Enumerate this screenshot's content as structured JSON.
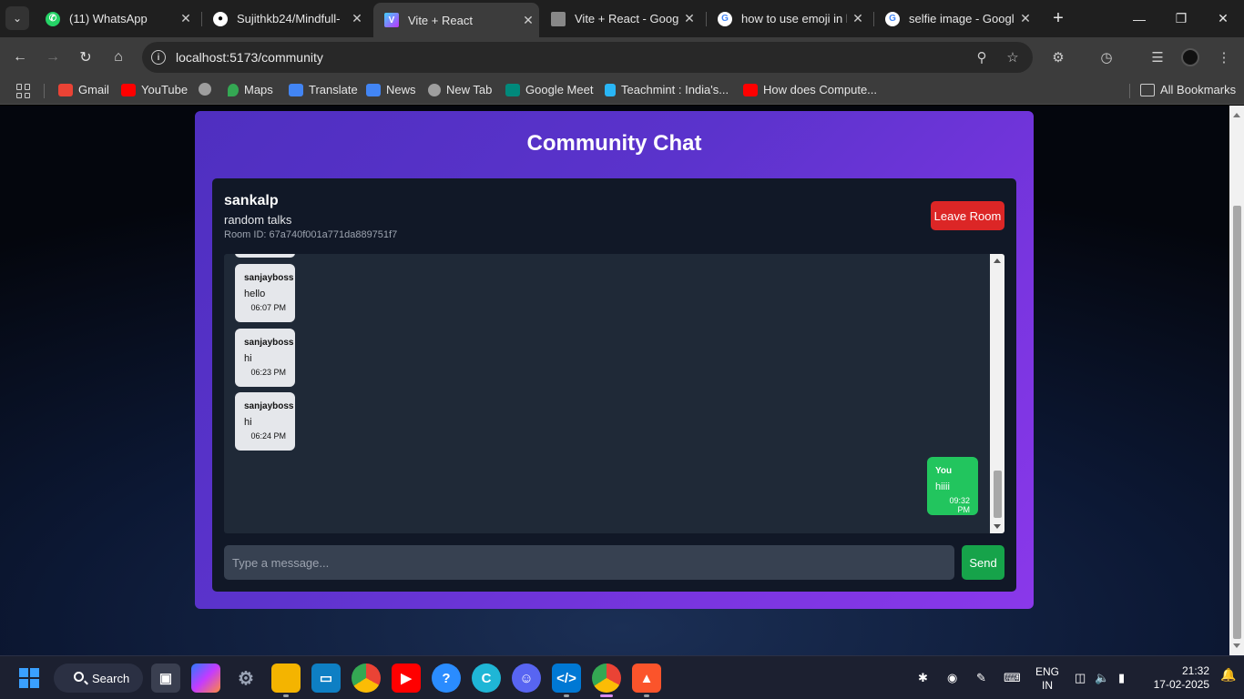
{
  "browser": {
    "tabs": [
      {
        "title": "(11) WhatsApp",
        "icon": "whatsapp-icon",
        "color": "#25d366"
      },
      {
        "title": "Sujithkb24/Mindfull-",
        "icon": "github-icon",
        "color": "#ffffff"
      },
      {
        "title": "Vite + React",
        "icon": "vite-icon",
        "color": "#a259ff"
      },
      {
        "title": "Vite + React - Google",
        "icon": "google-docs-icon",
        "color": "#bbbbbb"
      },
      {
        "title": "how to use emoji in l",
        "icon": "google-icon",
        "color": "#4285f4"
      },
      {
        "title": "selfie image - Google",
        "icon": "google-icon",
        "color": "#4285f4"
      }
    ],
    "active_tab": 2,
    "url": "localhost:5173/community",
    "bookmarks": [
      {
        "label": "Gmail",
        "color": "#ea4335"
      },
      {
        "label": "YouTube",
        "color": "#ff0000"
      },
      {
        "label": "",
        "color": "#9e9e9e"
      },
      {
        "label": "Maps",
        "color": "#34a853"
      },
      {
        "label": "Translate",
        "color": "#4285f4"
      },
      {
        "label": "News",
        "color": "#4285f4"
      },
      {
        "label": "New Tab",
        "color": "#9e9e9e"
      },
      {
        "label": "Google Meet",
        "color": "#00897b"
      },
      {
        "label": "Teachmint : India's...",
        "color": "#29b6f6"
      },
      {
        "label": "How does Compute...",
        "color": "#ff0000"
      }
    ],
    "all_bookmarks_label": "All Bookmarks"
  },
  "page": {
    "title": "Community Chat",
    "room": {
      "user": "sankalp",
      "name": "random talks",
      "id_text": "Room ID: 67a740f001a771da889751f7",
      "leave_label": "Leave Room"
    },
    "messages": [
      {
        "sender": "sanjayboss",
        "text": "hello",
        "time": "06:07 PM",
        "mine": false
      },
      {
        "sender": "sanjayboss",
        "text": "hi",
        "time": "06:23 PM",
        "mine": false
      },
      {
        "sender": "sanjayboss",
        "text": "hi",
        "time": "06:24 PM",
        "mine": false
      },
      {
        "sender": "You",
        "text": "hiiii",
        "time": "09:32 PM",
        "mine": true
      }
    ],
    "input_placeholder": "Type a message...",
    "send_label": "Send",
    "colors": {
      "accent_start": "#4f2fc0",
      "accent_end": "#8a38ea",
      "leave": "#dc2626",
      "send": "#16a34a",
      "own_bubble": "#22c55e"
    }
  },
  "taskbar": {
    "search_label": "Search",
    "lang_line1": "ENG",
    "lang_line2": "IN",
    "time": "21:32",
    "date": "17-02-2025"
  }
}
